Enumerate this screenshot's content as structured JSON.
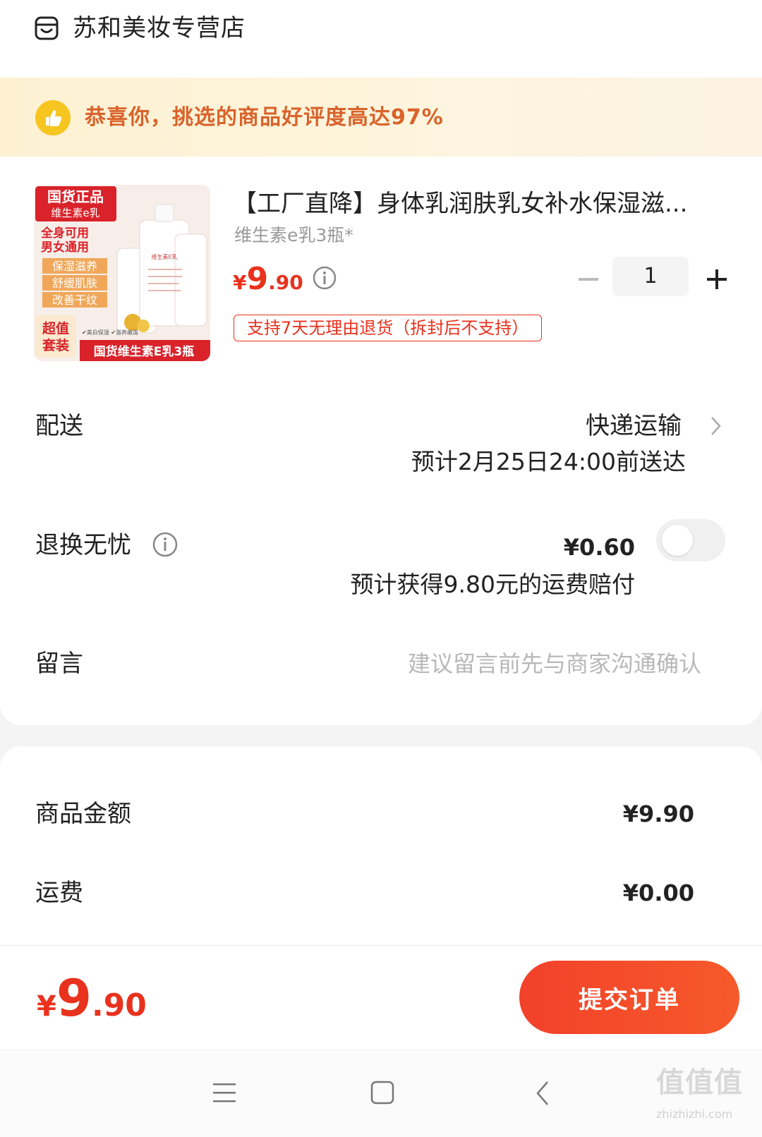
{
  "shop": {
    "name": "苏和美妆专营店",
    "icon": "shop-icon"
  },
  "banner": {
    "text": "恭喜你，挑选的商品好评度高达97%",
    "icon": "thumbs-up-icon"
  },
  "product": {
    "title": "【工厂直降】身体乳润肤乳女补水保湿滋...",
    "spec": "维生素e乳3瓶*",
    "price_symbol": "¥",
    "price_int": "9",
    "price_dec": ".90",
    "quantity": "1",
    "return_policy": "支持7天无理由退货（拆封后不支持）",
    "image": {
      "badge_top": "国货正品",
      "badge_sub": "维生素e乳",
      "features": [
        "全身可用",
        "男女通用",
        "保湿滋养",
        "舒缓肌肤",
        "改善干纹"
      ],
      "corner": [
        "超值",
        "套装"
      ],
      "bottom_band": "国货维生素E乳3瓶",
      "small_tags": "✔美白保湿 ✔滋养嫩滑",
      "bottle_label": "维生素E乳"
    }
  },
  "delivery": {
    "label": "配送",
    "method": "快递运输",
    "eta": "预计2月25日24:00前送达"
  },
  "return_insurance": {
    "label": "退换无忧",
    "price": "¥0.60",
    "note": "预计获得9.80元的运费赔付",
    "enabled": false
  },
  "message": {
    "label": "留言",
    "placeholder": "建议留言前先与商家沟通确认"
  },
  "summary": {
    "goods_label": "商品金额",
    "goods_value": "¥9.90",
    "shipping_label": "运费",
    "shipping_value": "¥0.00"
  },
  "checkout": {
    "total_symbol": "¥",
    "total_int": "9",
    "total_dec": ".90",
    "submit_label": "提交订单"
  },
  "watermark": {
    "text": "值值值",
    "url": "zhizhizhi.com"
  },
  "colors": {
    "accent": "#e8321e",
    "banner_text": "#d9632b",
    "thumb": "#f6c520"
  }
}
